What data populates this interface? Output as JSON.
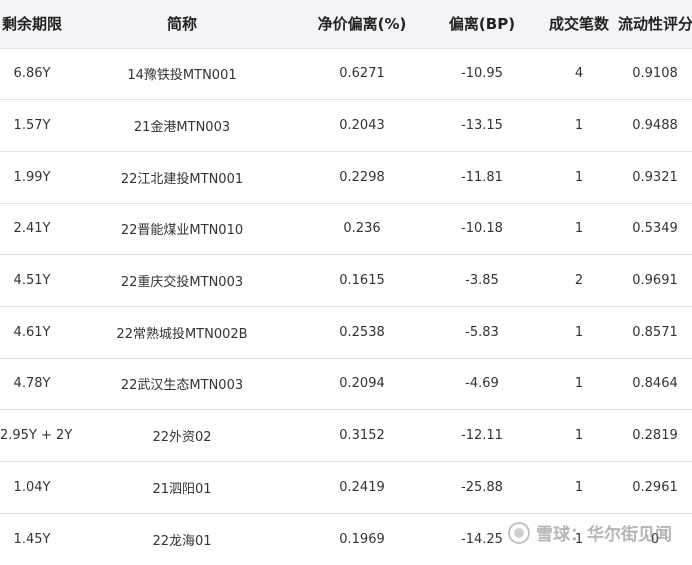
{
  "table": {
    "headers": [
      "剩余期限",
      "简称",
      "净价偏离(%)",
      "偏离(BP)",
      "成交笔数",
      "流动性评分"
    ],
    "rows": [
      [
        "6.86Y",
        "14豫铁投MTN001",
        "0.6271",
        "-10.95",
        "4",
        "0.9108"
      ],
      [
        "1.57Y",
        "21金港MTN003",
        "0.2043",
        "-13.15",
        "1",
        "0.9488"
      ],
      [
        "1.99Y",
        "22江北建投MTN001",
        "0.2298",
        "-11.81",
        "1",
        "0.9321"
      ],
      [
        "2.41Y",
        "22晋能煤业MTN010",
        "0.236",
        "-10.18",
        "1",
        "0.5349"
      ],
      [
        "4.51Y",
        "22重庆交投MTN003",
        "0.1615",
        "-3.85",
        "2",
        "0.9691"
      ],
      [
        "4.61Y",
        "22常熟城投MTN002B",
        "0.2538",
        "-5.83",
        "1",
        "0.8571"
      ],
      [
        "4.78Y",
        "22武汉生态MTN003",
        "0.2094",
        "-4.69",
        "1",
        "0.8464"
      ],
      [
        "2.95Y + 2Y",
        "22外资02",
        "0.3152",
        "-12.11",
        "1",
        "0.2819"
      ],
      [
        "1.04Y",
        "21泗阳01",
        "0.2419",
        "-25.88",
        "1",
        "0.2961"
      ],
      [
        "1.45Y",
        "22龙海01",
        "0.1969",
        "-14.25",
        "1",
        "0"
      ]
    ]
  },
  "watermark": {
    "text": "雪球：华尔街见闻"
  }
}
